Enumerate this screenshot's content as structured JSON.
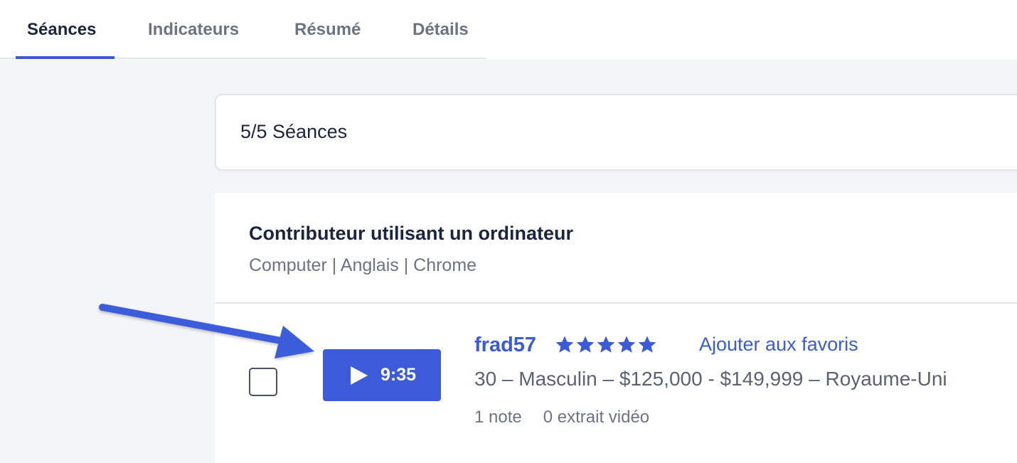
{
  "tabs": [
    {
      "label": "Séances",
      "active": true
    },
    {
      "label": "Indicateurs",
      "active": false
    },
    {
      "label": "Résumé",
      "active": false
    },
    {
      "label": "Détails",
      "active": false
    }
  ],
  "session_count": "5/5 Séances",
  "group": {
    "title": "Contributeur utilisant un ordinateur",
    "subtitle": "Computer | Anglais | Chrome"
  },
  "session": {
    "duration": "9:35",
    "username": "frad57",
    "rating": 5,
    "favorite_label": "Ajouter aux favoris",
    "demographics": "30 – Masculin – $125,000 - $149,999 – Royaume-Uni",
    "notes": "1 note",
    "clips": "0 extrait vidéo"
  },
  "colors": {
    "accent": "#3b5bdb",
    "annotation_arrow": "#3b5bdb"
  },
  "icons": {
    "play": "play-icon",
    "star": "star-icon",
    "annotation": "arrow-icon"
  }
}
